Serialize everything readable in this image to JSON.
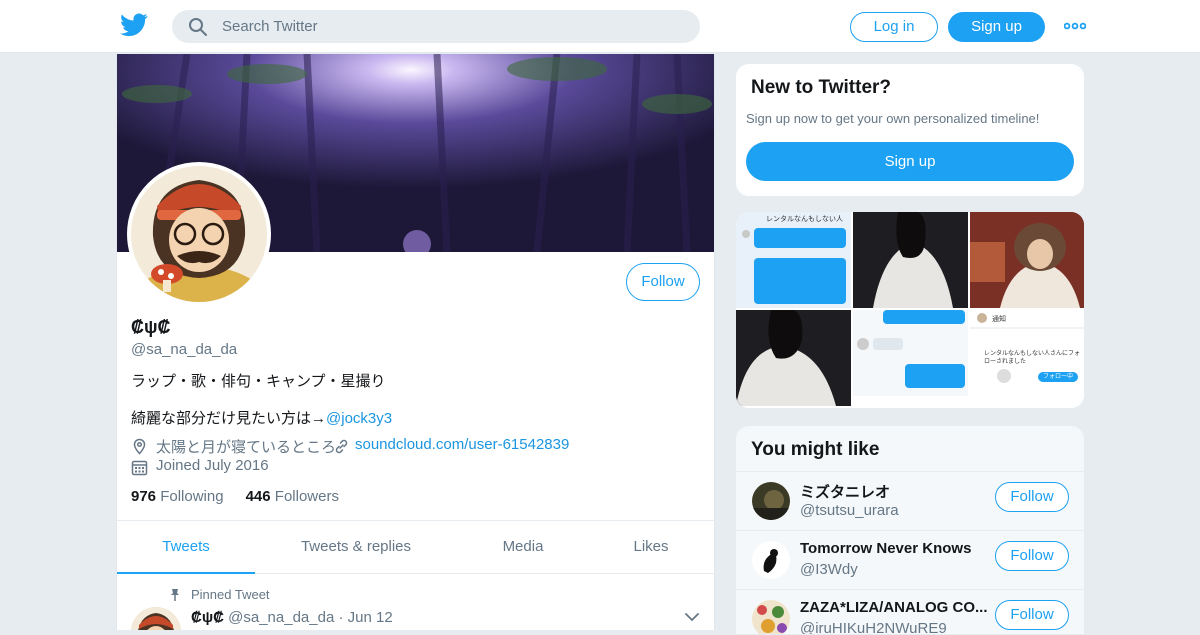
{
  "nav": {
    "search_placeholder": "Search Twitter",
    "login_label": "Log in",
    "signup_label": "Sign up"
  },
  "profile": {
    "name": "₡ψ₡",
    "handle": "@sa_na_da_da",
    "follow_label": "Follow",
    "bio_line1": "ラップ・歌・俳句・キャンプ・星撮り",
    "bio_line2_text": "綺麗な部分だけ見たい方は→",
    "bio_line2_link": "@jock3y3",
    "location": "太陽と月が寝ているところ",
    "url": "soundcloud.com/user-61542839",
    "joined": "Joined July 2016",
    "following_count": "976",
    "following_label": "Following",
    "followers_count": "446",
    "followers_label": "Followers"
  },
  "tabs": [
    {
      "label": "Tweets",
      "active": true
    },
    {
      "label": "Tweets & replies",
      "active": false
    },
    {
      "label": "Media",
      "active": false
    },
    {
      "label": "Likes",
      "active": false
    }
  ],
  "pinned": {
    "label": "Pinned Tweet",
    "name": "₡ψ₡",
    "handle": "@sa_na_da_da",
    "date": "Jun 12"
  },
  "new_to_twitter": {
    "title": "New to Twitter?",
    "subtitle": "Sign up now to get your own personalized timeline!",
    "signup_label": "Sign up"
  },
  "media_thumbs": {
    "chat1_title": "レンタルなんもしない人",
    "chat2_title": "通知",
    "chat2_text": "レンタルなんもしない人さんにフォローされました",
    "chat2_button": "フォロー中"
  },
  "might_like": {
    "title": "You might like",
    "follow_label": "Follow",
    "people": [
      {
        "name": "ミズタニレオ",
        "handle": "@tsutsu_urara"
      },
      {
        "name": "Tomorrow Never Knows",
        "handle": "@I3Wdy"
      },
      {
        "name": "ZAZA*LIZA/ANALOG CO...",
        "handle": "@iruHIKuH2NWuRE9"
      }
    ]
  },
  "colors": {
    "accent": "#1da1f2",
    "link": "#1b95e0",
    "muted": "#657786",
    "background": "#e6ecf0"
  },
  "icons": [
    "twitter-bird-icon",
    "search-icon",
    "more-dots-icon",
    "location-icon",
    "link-icon",
    "calendar-icon",
    "pin-icon",
    "chevron-down-icon"
  ]
}
